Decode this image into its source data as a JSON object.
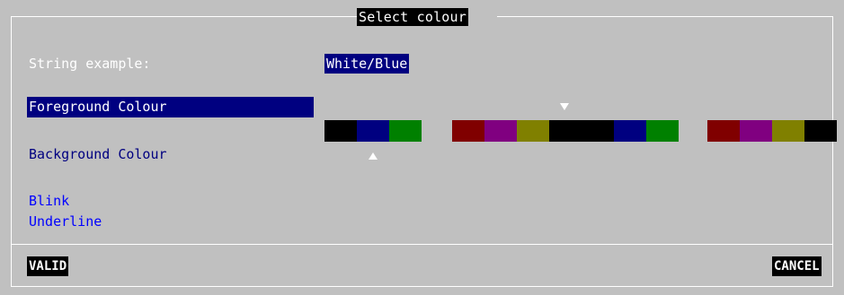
{
  "dialog": {
    "title": "Select colour",
    "string_example_label": "String example:",
    "string_example_value": "White/Blue",
    "foreground_label": "Foreground Colour",
    "background_label": "Background Colour",
    "blink_label": "Blink",
    "underline_label": "Underline",
    "selected_foreground": "White",
    "selected_background": "Blue"
  },
  "palette": {
    "group1": [
      "#000000",
      "#000080",
      "#008000"
    ],
    "group2": [
      "#800000",
      "#800080",
      "#808000",
      "#000000",
      "#000000",
      "#000080",
      "#008000"
    ],
    "group3": [
      "#800000",
      "#800080",
      "#808000",
      "#000000"
    ]
  },
  "buttons": {
    "valid": "VALID",
    "cancel": "CANCEL"
  },
  "colors": {
    "dialog_bg": "#c0c0c0",
    "highlight_bg": "#000080",
    "link_blue": "#0000ff",
    "border": "#ffffff"
  }
}
